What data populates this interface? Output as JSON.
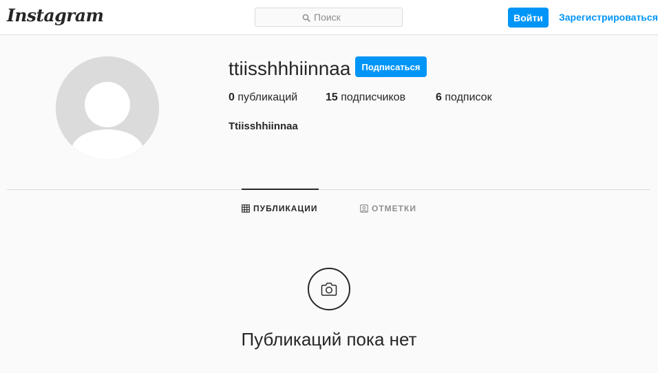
{
  "header": {
    "logo": "Instagram",
    "search_placeholder": "Поиск",
    "login_label": "Войти",
    "signup_label": "Зарегистрироваться"
  },
  "profile": {
    "username": "ttiisshhhiinnaa",
    "follow_label": "Подписаться",
    "stats": [
      {
        "count": "0",
        "label": " публикаций"
      },
      {
        "count": "15",
        "label": " подписчиков"
      },
      {
        "count": "6",
        "label": " подписок"
      }
    ],
    "full_name": "Ttiisshhiinnaa"
  },
  "tabs": [
    {
      "label": "ПУБЛИКАЦИИ",
      "icon": "grid-icon",
      "active": true
    },
    {
      "label": "ОТМЕТКИ",
      "icon": "tagged-user-icon",
      "active": false
    }
  ],
  "empty_state": {
    "icon": "camera-icon",
    "text": "Публикаций пока нет"
  },
  "colors": {
    "accent": "#0095f6",
    "background": "#fafafa",
    "text": "#262626",
    "muted": "#8e8e8e",
    "border": "#dbdbdb"
  }
}
